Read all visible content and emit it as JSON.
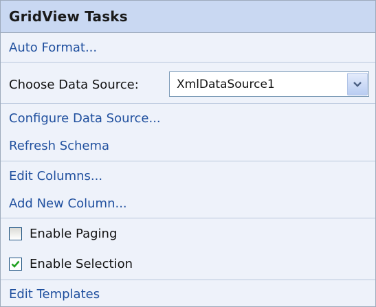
{
  "header": {
    "title": "GridView Tasks"
  },
  "tasks": {
    "auto_format": "Auto Format...",
    "choose_data_source_label": "Choose Data Source:",
    "data_source_value": "XmlDataSource1",
    "configure_data_source": "Configure Data Source...",
    "refresh_schema": "Refresh Schema",
    "edit_columns": "Edit Columns...",
    "add_new_column": "Add New Column...",
    "enable_paging": {
      "label": "Enable Paging",
      "checked": false
    },
    "enable_selection": {
      "label": "Enable Selection",
      "checked": true
    },
    "edit_templates": "Edit Templates"
  },
  "colors": {
    "header_bg": "#c9d8f2",
    "panel_bg": "#eef2fa",
    "link": "#1f4f9e",
    "check_mark": "#21a121"
  },
  "icons": {
    "dropdown": "chevron-down-icon",
    "check": "checkmark-icon"
  }
}
